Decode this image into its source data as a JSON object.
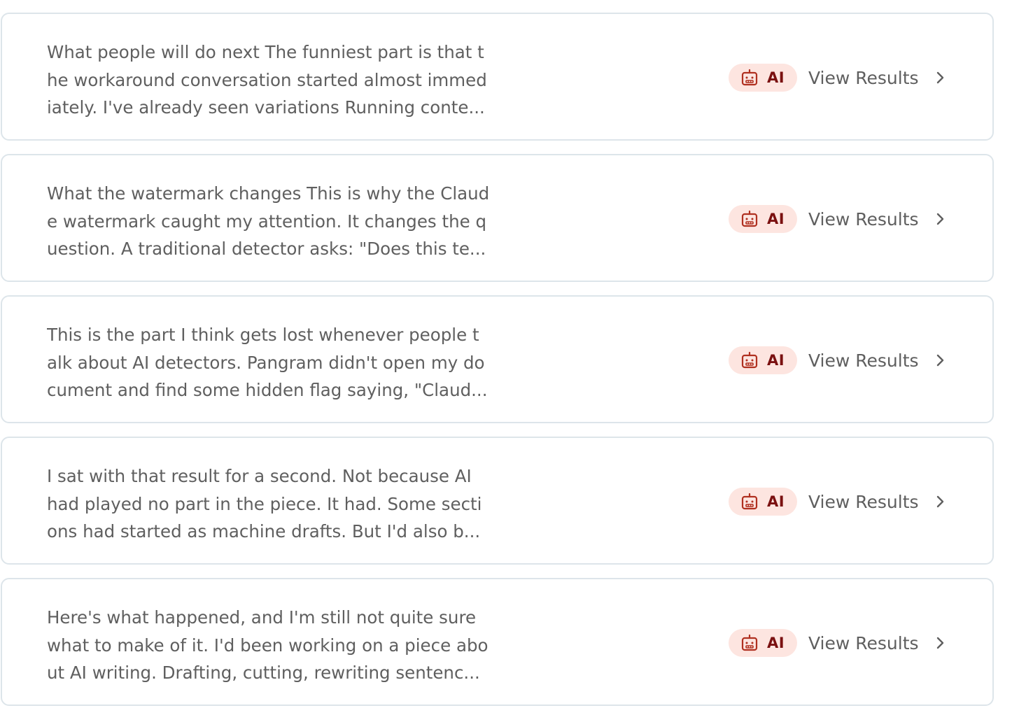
{
  "results": [
    {
      "snippet_lines": [
        "What people will do next The funniest part is that t",
        "he workaround conversation started almost immed",
        "iately. I've already seen variations Running conte..."
      ],
      "badge_label": "AI",
      "action_label": "View Results",
      "badge_icon": "robot-icon"
    },
    {
      "snippet_lines": [
        "What the watermark changes This is why the Claud",
        "e watermark caught my attention. It changes the q",
        "uestion. A traditional detector asks: \"Does this te..."
      ],
      "badge_label": "AI",
      "action_label": "View Results",
      "badge_icon": "robot-icon"
    },
    {
      "snippet_lines": [
        "This is the part I think gets lost whenever people t",
        "alk about AI detectors. Pangram didn't open my do",
        "cument and find some hidden flag saying, \"Claud..."
      ],
      "badge_label": "AI",
      "action_label": "View Results",
      "badge_icon": "robot-icon"
    },
    {
      "snippet_lines": [
        "I sat with that result for a second. Not because AI",
        "had played no part in the piece. It had. Some secti",
        "ons had started as machine drafts. But I'd also b..."
      ],
      "badge_label": "AI",
      "action_label": "View Results",
      "badge_icon": "robot-icon"
    },
    {
      "snippet_lines": [
        "Here's what happened, and I'm still not quite sure",
        "what to make of it. I'd been working on a piece abo",
        "ut AI writing. Drafting, cutting, rewriting sentenc..."
      ],
      "badge_label": "AI",
      "action_label": "View Results",
      "badge_icon": "robot-icon"
    }
  ],
  "colors": {
    "card_border": "#dde5ea",
    "snippet_text": "#5f5f5f",
    "badge_background": "#fde5e0",
    "badge_text": "#7a1010",
    "badge_icon": "#b03020",
    "chevron": "#5f5f5f"
  }
}
